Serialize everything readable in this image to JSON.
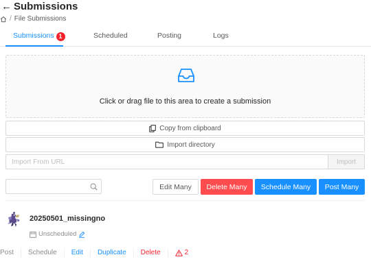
{
  "header": {
    "title": "Submissions",
    "breadcrumb_current": "File Submissions",
    "breadcrumb_sep": "/"
  },
  "tabs": [
    {
      "label": "Submissions",
      "badge": "1",
      "active": true
    },
    {
      "label": "Scheduled"
    },
    {
      "label": "Posting"
    },
    {
      "label": "Logs"
    }
  ],
  "dropzone": {
    "text": "Click or drag file to this area to create a submission"
  },
  "clipboard_label": "Copy from clipboard",
  "import_dir_label": "Import directory",
  "url_import": {
    "placeholder": "Import From URL",
    "button": "Import"
  },
  "search": {
    "value": ""
  },
  "bulk_actions": {
    "edit_many": "Edit Many",
    "delete_many": "Delete Many",
    "schedule_many": "Schedule Many",
    "post_many": "Post Many"
  },
  "submission": {
    "name": "20250501_missingno",
    "schedule_status": "Unscheduled",
    "actions": {
      "post": "Post",
      "schedule": "Schedule",
      "edit": "Edit",
      "duplicate": "Duplicate",
      "delete": "Delete",
      "problems_count": "2"
    }
  },
  "colors": {
    "primary": "#1890ff",
    "danger": "#ff4d4f",
    "badge": "#f5222d"
  }
}
